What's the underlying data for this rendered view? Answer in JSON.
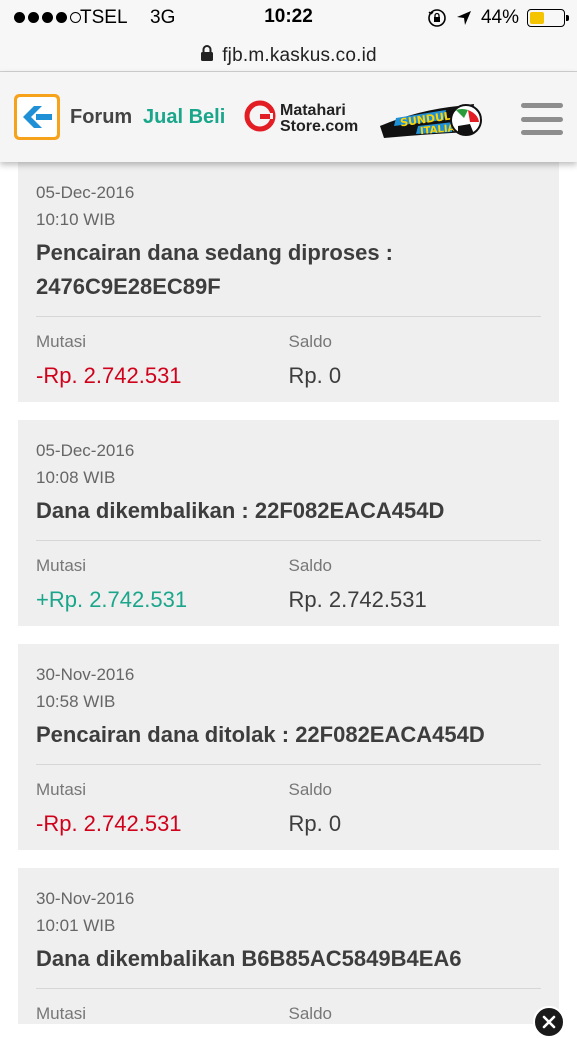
{
  "status_bar": {
    "carrier": "TSEL",
    "network": "3G",
    "time": "10:22",
    "battery_percent": "44%",
    "battery_level": 0.44,
    "battery_color": "#f5c400",
    "icons": [
      "signal-dots-icon",
      "orientation-lock-icon",
      "location-arrow-icon",
      "battery-icon"
    ]
  },
  "url_bar": {
    "url": "fjb.m.kaskus.co.id",
    "icon": "lock-icon"
  },
  "header": {
    "logo": "kaskus-logo-icon",
    "nav_forum": "Forum",
    "nav_jual_beli": "Jual Beli",
    "matahari_line1": "Matahari",
    "matahari_line2": "Store.com",
    "sundul_text1": "SUNDUL",
    "sundul_text2": "ITALIA",
    "menu_icon": "hamburger-menu-icon",
    "colors": {
      "kaskus_orange": "#f7a21b",
      "kaskus_blue": "#1f8fd6",
      "jual_beli_green": "#1aa68b",
      "matahari_red": "#e31d24"
    }
  },
  "labels": {
    "mutasi": "Mutasi",
    "saldo": "Saldo"
  },
  "transactions": [
    {
      "date": "05-Dec-2016",
      "time": "10:10 WIB",
      "title": "Pencairan dana sedang diproses : 2476C9E28EC89F",
      "mutasi": "-Rp. 2.742.531",
      "mutasi_type": "negative",
      "saldo": "Rp. 0"
    },
    {
      "date": "05-Dec-2016",
      "time": "10:08 WIB",
      "title": "Dana dikembalikan : 22F082EACA454D",
      "mutasi": "+Rp. 2.742.531",
      "mutasi_type": "positive",
      "saldo": "Rp. 2.742.531"
    },
    {
      "date": "30-Nov-2016",
      "time": "10:58 WIB",
      "title": "Pencairan dana ditolak : 22F082EACA454D",
      "mutasi": "-Rp. 2.742.531",
      "mutasi_type": "negative",
      "saldo": "Rp. 0"
    },
    {
      "date": "30-Nov-2016",
      "time": "10:01 WIB",
      "title": "Dana dikembalikan B6B85AC5849B4EA6",
      "mutasi": "",
      "mutasi_type": "positive",
      "saldo": ""
    }
  ],
  "colors": {
    "negative": "#d0021b",
    "positive": "#1aa68b",
    "card_bg": "#efefef"
  },
  "overlay": {
    "close_icon": "close-icon"
  }
}
